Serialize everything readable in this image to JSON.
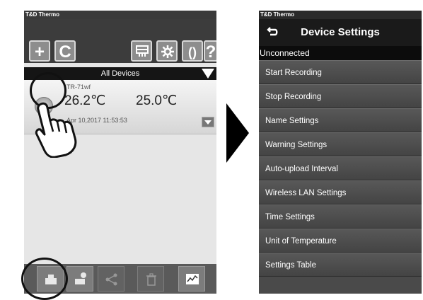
{
  "left_screen": {
    "status_bar": {
      "app_name": "T&D Thermo"
    },
    "toolbar": {
      "buttons": [
        {
          "label": "+",
          "icon": "add-icon"
        },
        {
          "label": "C",
          "icon": "refresh-icon"
        },
        {
          "icon": "display-icon"
        },
        {
          "icon": "gear-icon"
        },
        {
          "label": "()",
          "icon": "brackets-icon"
        },
        {
          "label": "?",
          "icon": "help-icon"
        }
      ]
    },
    "filter": {
      "label": "All Devices"
    },
    "device": {
      "name": "TR-71wf",
      "temp1": "26.2℃",
      "temp2": "25.0℃",
      "timestamp": "Apr 10,2017 11:53:53"
    },
    "bottom_toolbar": {
      "buttons": [
        {
          "icon": "device-settings-icon",
          "state": "enabled",
          "highlighted": true
        },
        {
          "icon": "device-info-icon",
          "state": "enabled"
        },
        {
          "icon": "share-icon",
          "state": "disabled"
        },
        {
          "icon": "trash-icon",
          "state": "disabled"
        },
        {
          "icon": "graph-icon",
          "state": "enabled"
        }
      ]
    }
  },
  "right_screen": {
    "status_bar": {
      "app_name": "T&D Thermo"
    },
    "header": {
      "title": "Device Settings",
      "back_icon": "back-arrow-icon"
    },
    "section_label": "Unconnected",
    "menu_items": [
      "Start Recording",
      "Stop Recording",
      "Name Settings",
      "Warning Settings",
      "Auto-upload Interval",
      "Wireless LAN Settings",
      "Time Settings",
      "Unit of Temperature",
      "Settings Table"
    ]
  },
  "colors": {
    "toolbar_bg": "#3c3c3c",
    "menu_bg": "#4a4a4a",
    "header_bg": "#1a1a1a"
  }
}
